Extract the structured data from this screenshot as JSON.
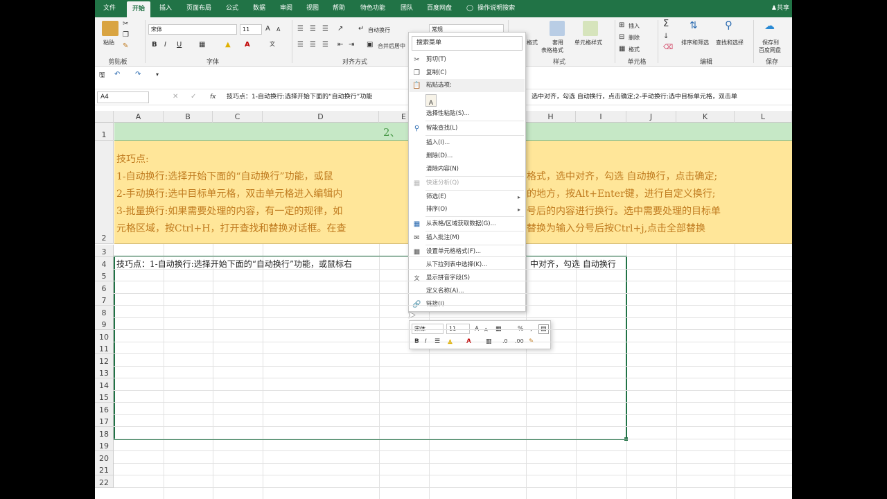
{
  "ribbon_tabs": [
    "文件",
    "开始",
    "插入",
    "页面布局",
    "公式",
    "数据",
    "审阅",
    "视图",
    "帮助",
    "特色功能",
    "团队",
    "百度网盘"
  ],
  "active_tab": "开始",
  "tell_me": "操作说明搜索",
  "share": "共享",
  "groups": {
    "clipboard": "剪贴板",
    "font": "字体",
    "alignment": "对齐方式",
    "styles": "样式",
    "cells": "单元格",
    "editing": "编辑",
    "save": "保存"
  },
  "clipboard": {
    "paste": "粘贴"
  },
  "font": {
    "name": "宋体",
    "size": "11"
  },
  "alignment": {
    "wrap": "自动换行",
    "merge": "合并后居中"
  },
  "number": {
    "format": "常规"
  },
  "styles": {
    "cond_format": "格式",
    "table_format_1": "套用",
    "table_format_2": "表格格式",
    "cell_styles": "单元格样式"
  },
  "cells": {
    "insert": "插入",
    "delete": "删除",
    "format": "格式"
  },
  "editing": {
    "sort_filter": "排序和筛选",
    "find_select": "查找和选择"
  },
  "save": {
    "line1": "保存到",
    "line2": "百度网盘"
  },
  "name_box": "A4",
  "formula": "技巧点：1-自动换行:选择开始下面的“自动换行”功能",
  "formula_right": "选中对齐，勾选 自动换行，点击确定;2-手动换行:选中目标单元格，双击单",
  "columns": [
    "A",
    "B",
    "C",
    "D",
    "E",
    "H",
    "I",
    "J",
    "K",
    "L"
  ],
  "rows": [
    "1",
    "2",
    "3",
    "4",
    "5",
    "6",
    "7",
    "8",
    "9",
    "10",
    "11",
    "12",
    "13",
    "14",
    "15",
    "16",
    "17",
    "18",
    "19",
    "20",
    "21",
    "22"
  ],
  "cells_content": {
    "row1_title": "2、",
    "tips": {
      "l0": "技巧点:",
      "l1a": "1-自动换行:选择开始下面的“自动换行”功能，或鼠",
      "l1b": "格式，选中对齐，勾选 自动换行，点击确定;",
      "l2a": "2-手动换行:选中目标单元格，双击单元格进入编辑内",
      "l2b": "的地方，按Alt+Enter键，进行自定义换行;",
      "l3a": "3-批量换行:如果需要处理的内容，有一定的规律，如",
      "l3b": "号后的内容进行换行。选中需要处理的目标单",
      "l4a": "元格区域，按Ctrl+H，打开查找和替换对话框。在查",
      "l4b": "替换为输入分号后按Ctrl+j,点击全部替换"
    },
    "a4a": "技巧点：1-自动换行:选择开始下面的“自动换行”功能，或鼠标右",
    "a4b": "中对齐，勾选 自动换行"
  },
  "context_menu": {
    "search": "搜索菜单",
    "items": {
      "cut": "剪切(T)",
      "copy": "复制(C)",
      "paste_options": "粘贴选项:",
      "paste_special": "选择性粘贴(S)...",
      "smart_lookup": "智能查找(L)",
      "insert": "插入(I)...",
      "delete": "删除(D)...",
      "clear": "清除内容(N)",
      "quick_analysis": "快速分析(Q)",
      "filter": "筛选(E)",
      "sort": "排序(O)",
      "from_table": "从表格/区域获取数据(G)...",
      "insert_comment": "插入批注(M)",
      "format_cells": "设置单元格格式(F)...",
      "pick_list": "从下拉列表中选择(K)...",
      "phonetic": "显示拼音字段(S)",
      "define_name": "定义名称(A)...",
      "link": "链接(I)"
    }
  },
  "mini_toolbar": {
    "font": "宋体",
    "size": "11"
  },
  "colors": {
    "excel_green": "#217346",
    "tip_fill": "#ffe699",
    "title_fill": "#c6e8c6",
    "tip_text": "#c07b1f"
  }
}
